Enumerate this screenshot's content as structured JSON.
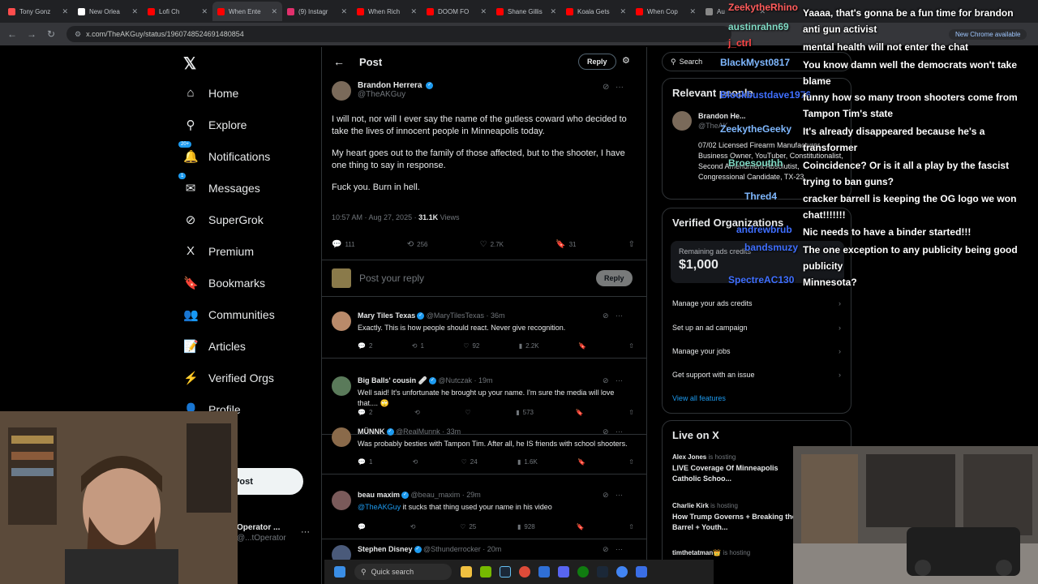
{
  "browser": {
    "tabs": [
      {
        "label": "Tony Gonz",
        "color": "#ff4d4d"
      },
      {
        "label": "New Orlea",
        "color": "#ffffff"
      },
      {
        "label": "Lofi Ch",
        "color": "#ff0000"
      },
      {
        "label": "When Ente",
        "color": "#ff0000"
      },
      {
        "label": "(9) Instagr",
        "color": "#e1306c"
      },
      {
        "label": "When Rich",
        "color": "#ff0000"
      },
      {
        "label": "DOOM FO",
        "color": "#ff0000"
      },
      {
        "label": "Shane Gillis",
        "color": "#ff0000"
      },
      {
        "label": "Koala Gets",
        "color": "#ff0000"
      },
      {
        "label": "When Cop",
        "color": "#ff0000"
      },
      {
        "label": "Au",
        "color": "#888888"
      }
    ],
    "url": "x.com/TheAKGuy/status/1960748524691480854",
    "new_chrome": "New Chrome available"
  },
  "nav": {
    "items": [
      {
        "label": "Home",
        "icon": "⌂",
        "iconname": "home-icon"
      },
      {
        "label": "Explore",
        "icon": "⚲",
        "iconname": "search-icon"
      },
      {
        "label": "Notifications",
        "icon": "🔔",
        "iconname": "bell-icon",
        "badge": "20+"
      },
      {
        "label": "Messages",
        "icon": "✉",
        "iconname": "mail-icon",
        "badge": "1"
      },
      {
        "label": "SuperGrok",
        "icon": "⊘",
        "iconname": "grok-icon"
      },
      {
        "label": "Premium",
        "icon": "X",
        "iconname": "x-premium-icon"
      },
      {
        "label": "Bookmarks",
        "icon": "🔖",
        "iconname": "bookmark-icon"
      },
      {
        "label": "Communities",
        "icon": "👥",
        "iconname": "communities-icon"
      },
      {
        "label": "Articles",
        "icon": "📝",
        "iconname": "articles-icon"
      },
      {
        "label": "Verified Orgs",
        "icon": "⚡",
        "iconname": "lightning-icon"
      },
      {
        "label": "Profile",
        "icon": "👤",
        "iconname": "person-icon"
      }
    ],
    "post_button": "Post",
    "account": {
      "name": "Operator ...",
      "handle": "@...tOperator"
    }
  },
  "post": {
    "header_title": "Post",
    "reply_label": "Reply",
    "author": {
      "name": "Brandon Herrera",
      "handle": "@TheAKGuy"
    },
    "paragraphs": [
      "I will not, nor will I ever say the name of the gutless coward who decided to take the lives of innocent people in Minneapolis today.",
      "My heart goes out to the family of those affected, but to the shooter, I have one thing to say in response.",
      "Fuck you. Burn in hell."
    ],
    "time": "10:57 AM · Aug 27, 2025 · ",
    "views_count": "31.1K",
    "views_label": " Views",
    "stats": {
      "replies": "111",
      "reposts": "256",
      "likes": "2.7K",
      "bookmarks": "31"
    },
    "reply_placeholder": "Post your reply",
    "reply_button": "Reply"
  },
  "replies": [
    {
      "name": "Mary Tiles Texas",
      "handle": "@MaryTilesTexas · 36m",
      "text": "Exactly. This is how people should react. Never give recognition.",
      "stats": [
        "2",
        "1",
        "92",
        "2.2K"
      ],
      "avcolor": "#b98a6a"
    },
    {
      "name": "Big Balls' cousin 🩹",
      "handle": "@Nutczak · 19m",
      "text": "Well said! It's unfortunate he brought up your name. I'm sure the media will love that.... 🙄",
      "stats": [
        "2",
        "",
        "",
        "573"
      ],
      "avcolor": "#5a7a5a"
    },
    {
      "name": "MÜNNK",
      "handle": "@RealMunnk · 33m",
      "text": "Was probably besties with Tampon Tim. After all, he IS friends with school shooters.",
      "stats": [
        "1",
        "",
        "24",
        "1.6K"
      ],
      "avcolor": "#8a6a4a"
    },
    {
      "name": "beau maxim",
      "handle": "@beau_maxim · 29m",
      "text": "@TheAKGuy it sucks that thing used your name in his video",
      "stats": [
        "",
        "",
        "25",
        "928"
      ],
      "avcolor": "#7a5a5a"
    },
    {
      "name": "Stephen Disney",
      "handle": "@Sthunderrocker · 20m",
      "text": "",
      "stats": [],
      "avcolor": "#4a5a7a"
    }
  ],
  "right": {
    "search": "Search",
    "relevant_title": "Relevant people",
    "relevant": {
      "name": "Brandon He...",
      "handle": "@TheAK...",
      "bio": "07/02 Licensed Firearm Manufacturer, Business Owner, YouTuber, Constitutionalist, Second Amendment Absolutist, Congressional Candidate, TX-23"
    },
    "verified_title": "Verified Organizations",
    "credits_label": "Remaining ads credits",
    "credits_value": "$1,000",
    "links": [
      "Manage your ads credits",
      "Set up an ad campaign",
      "Manage your jobs",
      "Get support with an issue"
    ],
    "view_all": "View all features",
    "live_title": "Live on X",
    "live": [
      {
        "host": "Alex Jones",
        "status": "is hosting",
        "title": "LIVE Coverage Of Minneapolis Catholic Schoo..."
      },
      {
        "host": "Charlie Kirk",
        "status": "is hosting",
        "title": "How Trump Governs + Breaking the Barrel + Youth..."
      },
      {
        "host": "timthetatman👑",
        "status": "is hosting",
        "title": ""
      }
    ]
  },
  "chat": [
    {
      "name": "ZeekytheRhino",
      "color": "#ff5b5b",
      "text": "Yaaaa, that's gonna be a fun time for brandon"
    },
    {
      "name": "austinrahn69",
      "color": "#7fd9c3",
      "text": "anti gun activist"
    },
    {
      "name": "j_ctrl",
      "color": "#ff4444",
      "text": "mental health will not enter the chat"
    },
    {
      "name": "BlackMyst0817",
      "color": "#7fb8ff",
      "text": "You know damn well the democrats won't take blame"
    },
    {
      "name": "Blockbustdave1976",
      "color": "#3f6fff",
      "text": "funny how so many troon shooters come from Tampon Tim's state"
    },
    {
      "name": "ZeekytheGeeky",
      "color": "#7fb8ff",
      "text": "It's already disappeared because he's a transformer"
    },
    {
      "name": "Broesouthh",
      "color": "#7fd9c3",
      "text": "Coincidence? Or is it all a play by the fascist trying to ban guns?"
    },
    {
      "name": "Thred4",
      "color": "#7fb8ff",
      "text": "cracker barrell is keeping the OG logo we won chat!!!!!!!"
    },
    {
      "name": "andrewbrub",
      "color": "#3f6fff",
      "text": "Nic needs to have a binder started!!!"
    },
    {
      "name": "bandsmuzy",
      "color": "#3f6fff",
      "text": "The one exception to any publicity being good publicity"
    },
    {
      "name": "SpectreAC130",
      "color": "#3f6fff",
      "text": "Minnesota?"
    }
  ],
  "taskbar": {
    "search": "Quick search"
  }
}
